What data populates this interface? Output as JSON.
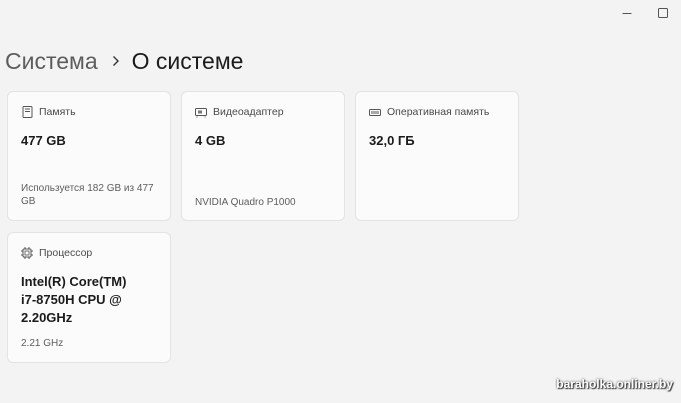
{
  "window": {
    "controls": {
      "minimize": "minimize-icon",
      "maximize": "maximize-icon"
    }
  },
  "breadcrumb": {
    "parent": "Система",
    "separator_icon": "chevron-right-icon",
    "current": "О системе"
  },
  "cards": {
    "memory": {
      "icon": "storage-icon",
      "label": "Память",
      "value": "477 GB",
      "sub": "Используется 182 GB из 477 GB"
    },
    "gpu": {
      "icon": "display-adapter-icon",
      "label": "Видеоадаптер",
      "value": "4 GB",
      "sub": "NVIDIA Quadro P1000"
    },
    "ram": {
      "icon": "ram-icon",
      "label": "Оперативная память",
      "value": "32,0 ГБ"
    },
    "cpu": {
      "icon": "processor-icon",
      "label": "Процессор",
      "value": "Intel(R) Core(TM) i7-8750H CPU @ 2.20GHz",
      "sub": "2.21 GHz"
    }
  },
  "watermark": "baraholka.onliner.by",
  "colors": {
    "background": "#f3f3f3",
    "card": "#fbfbfb",
    "border": "#e3e3e3"
  }
}
